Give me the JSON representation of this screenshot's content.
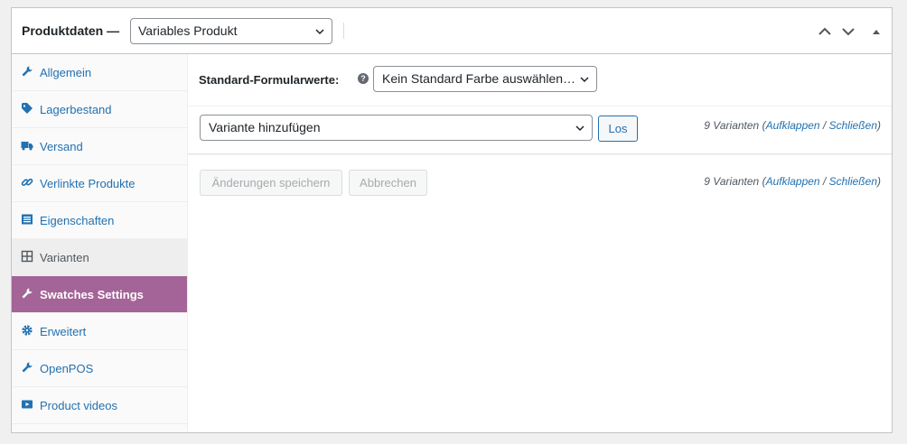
{
  "header": {
    "title": "Produktdaten —",
    "product_type": "Variables Produkt"
  },
  "sidebar": {
    "items": [
      {
        "label": "Allgemein",
        "icon": "wrench-icon"
      },
      {
        "label": "Lagerbestand",
        "icon": "tag-icon"
      },
      {
        "label": "Versand",
        "icon": "truck-icon"
      },
      {
        "label": "Verlinkte Produkte",
        "icon": "link-icon"
      },
      {
        "label": "Eigenschaften",
        "icon": "list-icon"
      },
      {
        "label": "Varianten",
        "icon": "grid-icon"
      },
      {
        "label": "Swatches Settings",
        "icon": "wrench-icon"
      },
      {
        "label": "Erweitert",
        "icon": "gear-icon"
      },
      {
        "label": "OpenPOS",
        "icon": "wrench-icon"
      },
      {
        "label": "Product videos",
        "icon": "video-icon"
      }
    ]
  },
  "defaults": {
    "label": "Standard-Formularwerte:",
    "help": "?",
    "selected": "Kein Standard Farbe auswählen…"
  },
  "actions": {
    "selected": "Variante hinzufügen",
    "go_label": "Los"
  },
  "variations": {
    "count_text": "9 Varianten (",
    "expand": "Aufklappen",
    "sep": " / ",
    "close": "Schließen",
    "end": ")"
  },
  "buttons": {
    "save": "Änderungen speichern",
    "cancel": "Abbrechen"
  },
  "colors": {
    "accent": "#2271b1",
    "highlight": "#a46497"
  }
}
